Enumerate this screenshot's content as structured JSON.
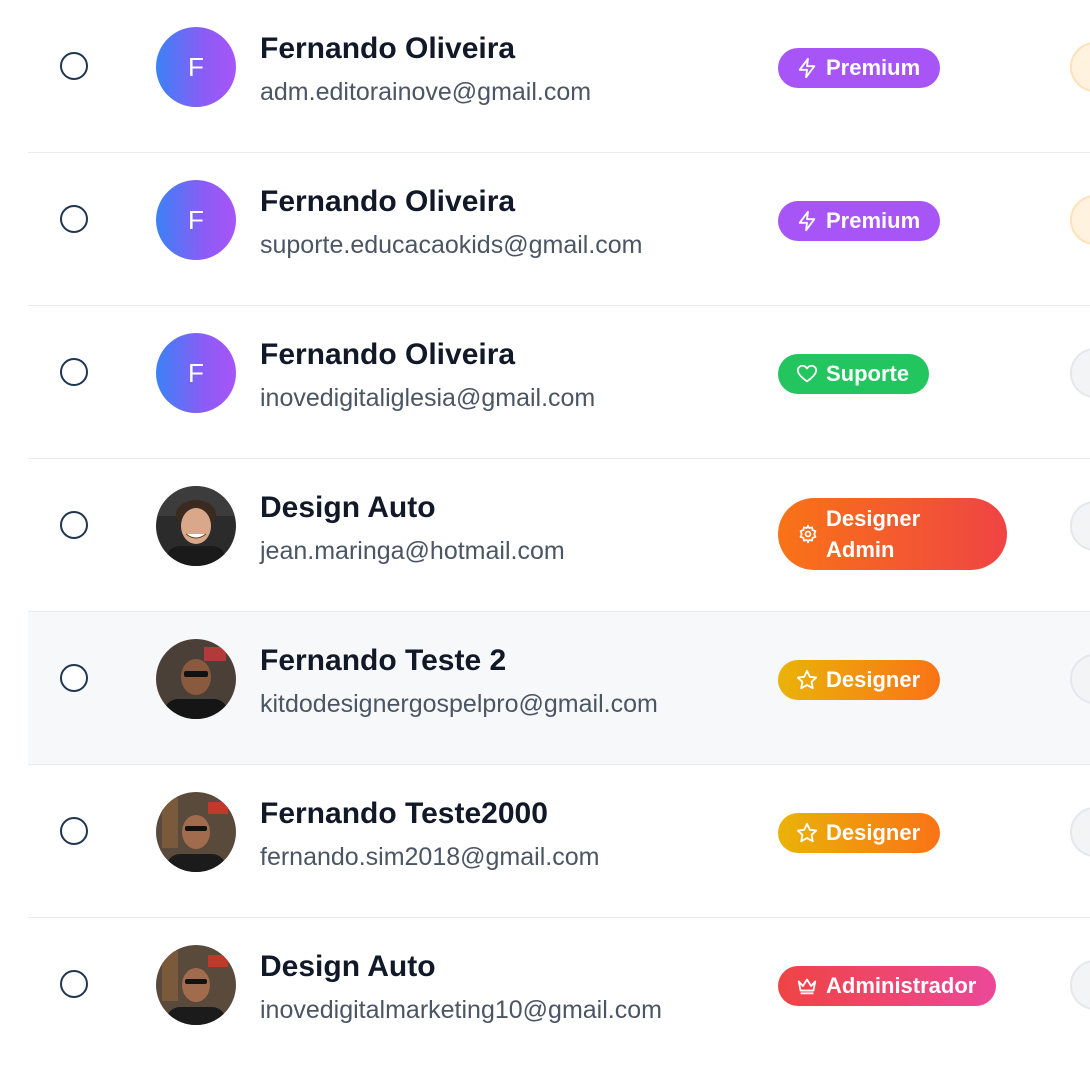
{
  "users": [
    {
      "name": "Fernando Oliveira",
      "email": "adm.editorainove@gmail.com",
      "avatar": "initial",
      "initial": "F",
      "role": "Premium",
      "role_type": "premium",
      "role_icon": "lightning-icon",
      "edge": "orange"
    },
    {
      "name": "Fernando Oliveira",
      "email": "suporte.educacaokids@gmail.com",
      "avatar": "initial",
      "initial": "F",
      "role": "Premium",
      "role_type": "premium",
      "role_icon": "lightning-icon",
      "edge": "orange"
    },
    {
      "name": "Fernando Oliveira",
      "email": "inovedigitaliglesia@gmail.com",
      "avatar": "initial",
      "initial": "F",
      "role": "Suporte",
      "role_type": "suporte",
      "role_icon": "heart-icon",
      "edge": "grey"
    },
    {
      "name": "Design Auto",
      "email": "jean.maringa@hotmail.com",
      "avatar": "photo",
      "role": "Designer Admin",
      "role_type": "admin-designer",
      "role_icon": "gear-icon",
      "edge": "grey"
    },
    {
      "name": "Fernando Teste 2",
      "email": "kitdodesignergospelpro@gmail.com",
      "avatar": "photo",
      "role": "Designer",
      "role_type": "designer",
      "role_icon": "star-icon",
      "edge": "grey"
    },
    {
      "name": "Fernando Teste2000",
      "email": "fernando.sim2018@gmail.com",
      "avatar": "photo",
      "role": "Designer",
      "role_type": "designer",
      "role_icon": "star-icon",
      "edge": "grey"
    },
    {
      "name": "Design Auto",
      "email": "inovedigitalmarketing10@gmail.com",
      "avatar": "photo",
      "role": "Administrador",
      "role_type": "administrador",
      "role_icon": "crown-icon",
      "edge": "grey"
    }
  ],
  "colors": {
    "premium": "#a855f7",
    "suporte": "#22c55e",
    "designer_from": "#eab308",
    "designer_to": "#f97316",
    "admin_from": "#ef4444",
    "admin_to": "#ec4899"
  }
}
